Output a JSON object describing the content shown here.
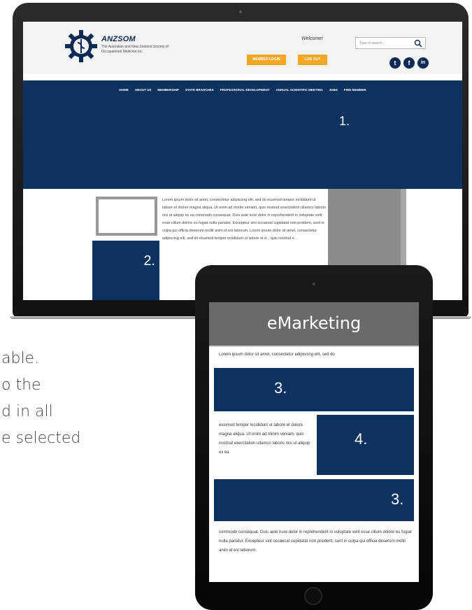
{
  "laptop": {
    "brand": {
      "title": "ANZSOM",
      "subtitle": "The Australian and New Zealand Society of Occupational Medicine Inc"
    },
    "welcome": "Welcome!",
    "buttons": {
      "member_login": "MEMBER LOGIN",
      "log_out": "LOG OUT"
    },
    "search": {
      "placeholder": "Type to search..."
    },
    "social": [
      {
        "icon": "twitter-icon",
        "glyph": "t"
      },
      {
        "icon": "facebook-icon",
        "glyph": "f"
      },
      {
        "icon": "linkedin-icon",
        "glyph": "in"
      }
    ],
    "nav": [
      "HOME",
      "ABOUT US",
      "MEMBERSHIP",
      "STATE BRANCHES",
      "PROFESSIONAL DEVELOPMENT",
      "ANNUAL SCIENTIFIC MEETING",
      "JOBS",
      "FIND MEMBER"
    ],
    "hero_number": "1.",
    "block_number": "2.",
    "lorem": "Lorem ipsum dolor sit amet, consectetur adipiscing elit, sed do eiusmod tempor incididunt ut labore et dolore magna aliqua. Ut enim ad minim veniam, quis nostrud exercitation ullamco laboris nisi ut aliquip ex ea commodo consequat. Duis aute irure dolor in reprehenderit in voluptate velit esse cillum dolore eu fugiat nulla pariatur. Excepteur sint occaecat cupidatat non proident, sunt in culpa qui officia deserunt mollit anim id est laborum. Lorem ipsum dolor sit amet, consectetur adipiscing elit, sed do eiusmod tempor incididunt ut labore et d... quis nostrud e..."
  },
  "background_text": {
    "line1": "able.",
    "line2": "o the",
    "line3": "d in all",
    "line4": "e selected"
  },
  "tablet": {
    "title": "eMarketing",
    "lorem_top": "Lorem ipsum dolor sit amet, consectetur adipiscing elit, sed do",
    "block3_number": "3.",
    "lorem_mid": "eiusmod tempor incididunt ut labore et dolore magna aliqua. Ut enim ad minim veniam, quis nostrud exercitation ullamco laboris nisi ut aliquip ex ea",
    "block4_number": "4.",
    "block3b_number": "3.",
    "lorem_bottom": "commodo consequat. Duis aute irure dolor in reprehenderit in voluptate velit esse cillum dolore eu fugiat nulla pariatur. Excepteur sint occaecat cupidatat non proident, sunt in culpa qui officia deserunt mollit anim id est laborum."
  },
  "colors": {
    "navy": "#0d3260",
    "orange": "#f5a623",
    "gray_header": "#6a6a6a"
  }
}
